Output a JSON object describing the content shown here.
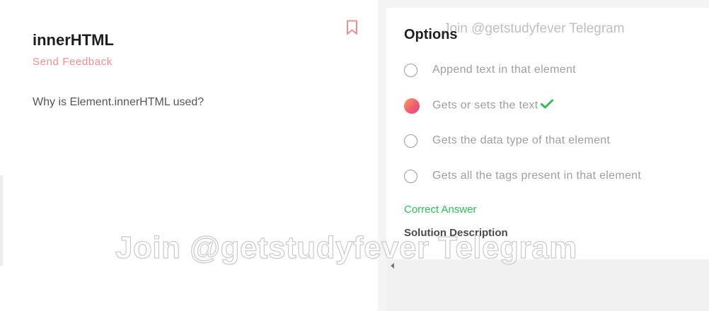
{
  "question": {
    "title": "innerHTML",
    "feedback_label": "Send Feedback",
    "text": "Why is Element.innerHTML used?"
  },
  "options": {
    "title": "Options",
    "items": [
      {
        "label": "Append text in that element",
        "selected": false
      },
      {
        "label": "Gets or sets the text",
        "selected": true,
        "correct": true
      },
      {
        "label": "Gets the data type of that element",
        "selected": false
      },
      {
        "label": "Gets all the tags present in that element",
        "selected": false
      }
    ]
  },
  "result": {
    "correct_label": "Correct Answer",
    "solution_heading": "Solution Description"
  },
  "watermark": {
    "top": "Join @getstudyfever Telegram",
    "center": "Join @getstudyfever Telegram"
  },
  "icons": {
    "bookmark": "bookmark-icon",
    "check": "check-icon",
    "scroll_left": "chevron-left-icon"
  },
  "colors": {
    "feedback": "#f08f8f",
    "correct": "#2ebd59",
    "selected_gradient_start": "#f6a15b",
    "selected_gradient_end": "#e8457d"
  }
}
